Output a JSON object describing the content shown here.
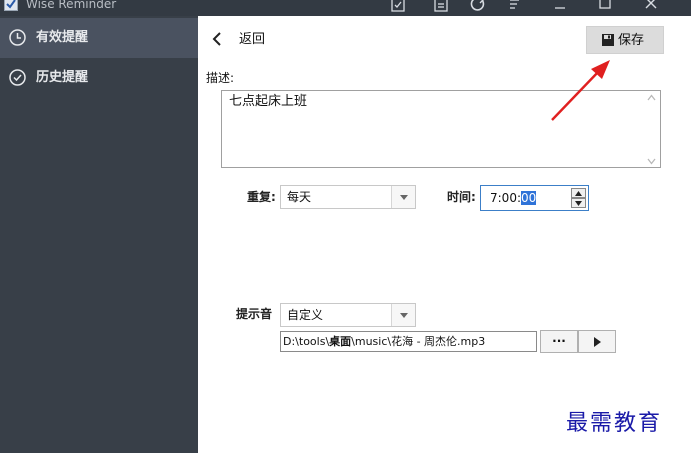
{
  "window": {
    "title": "Wise Reminder",
    "toolbar_icons": [
      "task-icon",
      "calendar-icon",
      "refresh-icon",
      "sort-icon",
      "minimize-icon",
      "maximize-icon",
      "close-icon"
    ]
  },
  "sidebar": {
    "items": [
      {
        "label": "有效提醒",
        "icon": "clock-icon",
        "active": true
      },
      {
        "label": "历史提醒",
        "icon": "check-circle-icon",
        "active": false
      }
    ]
  },
  "main": {
    "back_label": "返回",
    "save_label": "保存",
    "description": {
      "label": "描述:",
      "value": "七点起床上班"
    },
    "repeat": {
      "label": "重复:",
      "value": "每天"
    },
    "time": {
      "label": "时间:",
      "value_prefix": "7:00:",
      "value_selected": "00"
    },
    "sound": {
      "label": "提示音",
      "mode_value": "自定义",
      "path_prefix": "D:\\tools\\",
      "path_desktop": "桌面",
      "path_suffix": "\\music\\花海 - 周杰伦.mp3",
      "browse_label": "···"
    }
  },
  "watermark": "最需教育",
  "colors": {
    "sidebar_bg": "#383f48",
    "sidebar_active_bg": "#4a5260",
    "titlebar_bg": "#333a43",
    "accent_selection": "#2f73d8",
    "arrow": "#e02020",
    "watermark": "#1a1aa8"
  }
}
